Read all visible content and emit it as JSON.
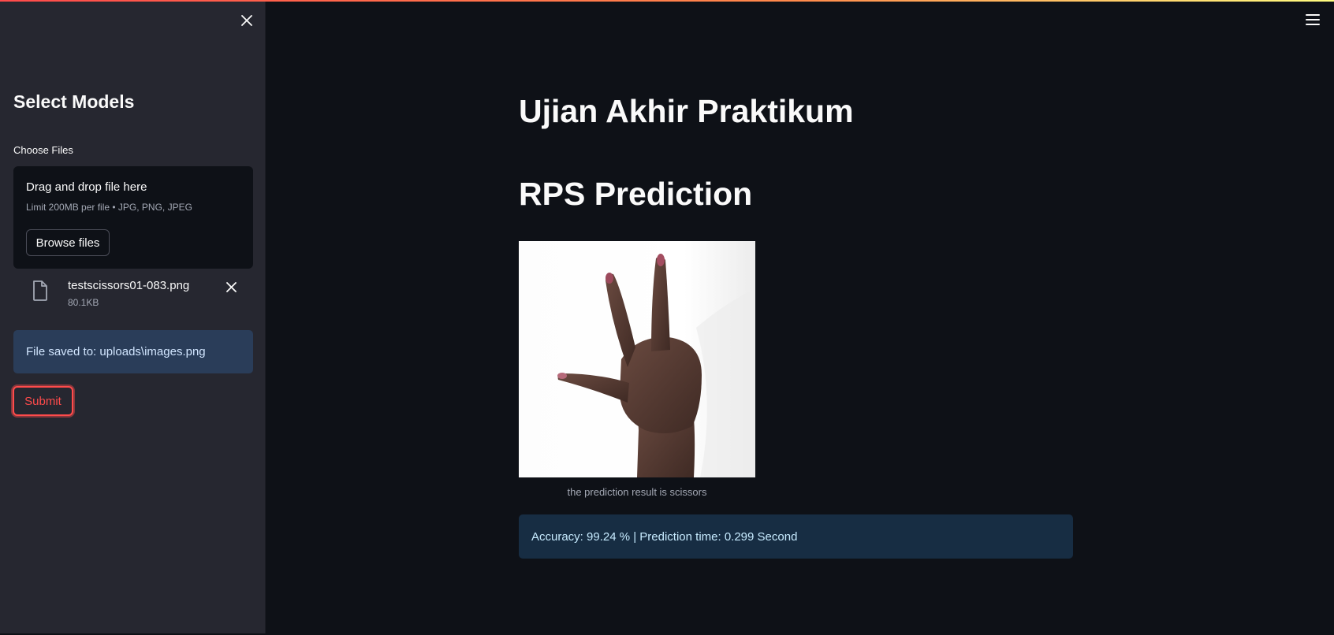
{
  "sidebar": {
    "title": "Select Models",
    "uploader": {
      "label": "Choose Files",
      "drop_title": "Drag and drop file here",
      "limit_text": "Limit 200MB per file • JPG, PNG, JPEG",
      "browse_label": "Browse files"
    },
    "file": {
      "name": "testscissors01-083.png",
      "size": "80.1KB"
    },
    "saved_message": "File saved to: uploads\\images.png",
    "submit_label": "Submit"
  },
  "main": {
    "title": "Ujian Akhir Praktikum",
    "subtitle": "RPS Prediction",
    "image_caption": "the prediction result is scissors",
    "result_message": "Accuracy: 99.24 % | Prediction time: 0.299 Second"
  },
  "icons": {
    "close": "close-icon",
    "file": "file-icon",
    "menu": "hamburger-menu-icon"
  },
  "colors": {
    "accent": "#ff4b4b",
    "background": "#0e1117",
    "sidebar": "#262730",
    "info_bg": "#172d43"
  }
}
